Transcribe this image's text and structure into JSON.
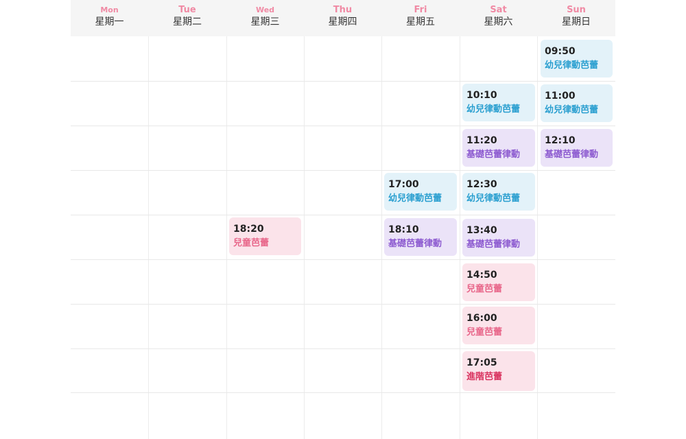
{
  "days": [
    {
      "en": "Mon",
      "zh": "星期一"
    },
    {
      "en": "Tue",
      "zh": "星期二"
    },
    {
      "en": "Wed",
      "zh": "星期三"
    },
    {
      "en": "Thu",
      "zh": "星期四"
    },
    {
      "en": "Fri",
      "zh": "星期五"
    },
    {
      "en": "Sat",
      "zh": "星期六"
    },
    {
      "en": "Sun",
      "zh": "星期日"
    }
  ],
  "events": {
    "sun_0950": {
      "time": "09:50",
      "name": "幼兒律動芭蕾",
      "color": "blue"
    },
    "sat_1010": {
      "time": "10:10",
      "name": "幼兒律動芭蕾",
      "color": "blue"
    },
    "sun_1100": {
      "time": "11:00",
      "name": "幼兒律動芭蕾",
      "color": "blue"
    },
    "sat_1120": {
      "time": "11:20",
      "name": "基礎芭蕾律動",
      "color": "purple"
    },
    "sun_1210": {
      "time": "12:10",
      "name": "基礎芭蕾律動",
      "color": "purple"
    },
    "fri_1700": {
      "time": "17:00",
      "name": "幼兒律動芭蕾",
      "color": "blue"
    },
    "sat_1230": {
      "time": "12:30",
      "name": "幼兒律動芭蕾",
      "color": "blue"
    },
    "wed_1820": {
      "time": "18:20",
      "name": "兒童芭蕾",
      "color": "pink"
    },
    "fri_1810": {
      "time": "18:10",
      "name": "基礎芭蕾律動",
      "color": "purple"
    },
    "sat_1340": {
      "time": "13:40",
      "name": "基礎芭蕾律動",
      "color": "purple"
    },
    "sat_1450": {
      "time": "14:50",
      "name": "兒童芭蕾",
      "color": "pink"
    },
    "sat_1600": {
      "time": "16:00",
      "name": "兒童芭蕾",
      "color": "pink"
    },
    "sat_1705": {
      "time": "17:05",
      "name": "進階芭蕾",
      "color": "red"
    }
  },
  "colors": {
    "header_bg": "#f5f5f5",
    "day_en": "#f08aa4",
    "blue_bg": "#e3f2f9",
    "blue_text": "#2a9fd0",
    "purple_bg": "#ebe3f8",
    "purple_text": "#8d5bd0",
    "pink_bg": "#fbe3ea",
    "pink_text": "#e8668a",
    "red_text": "#d9335f"
  }
}
